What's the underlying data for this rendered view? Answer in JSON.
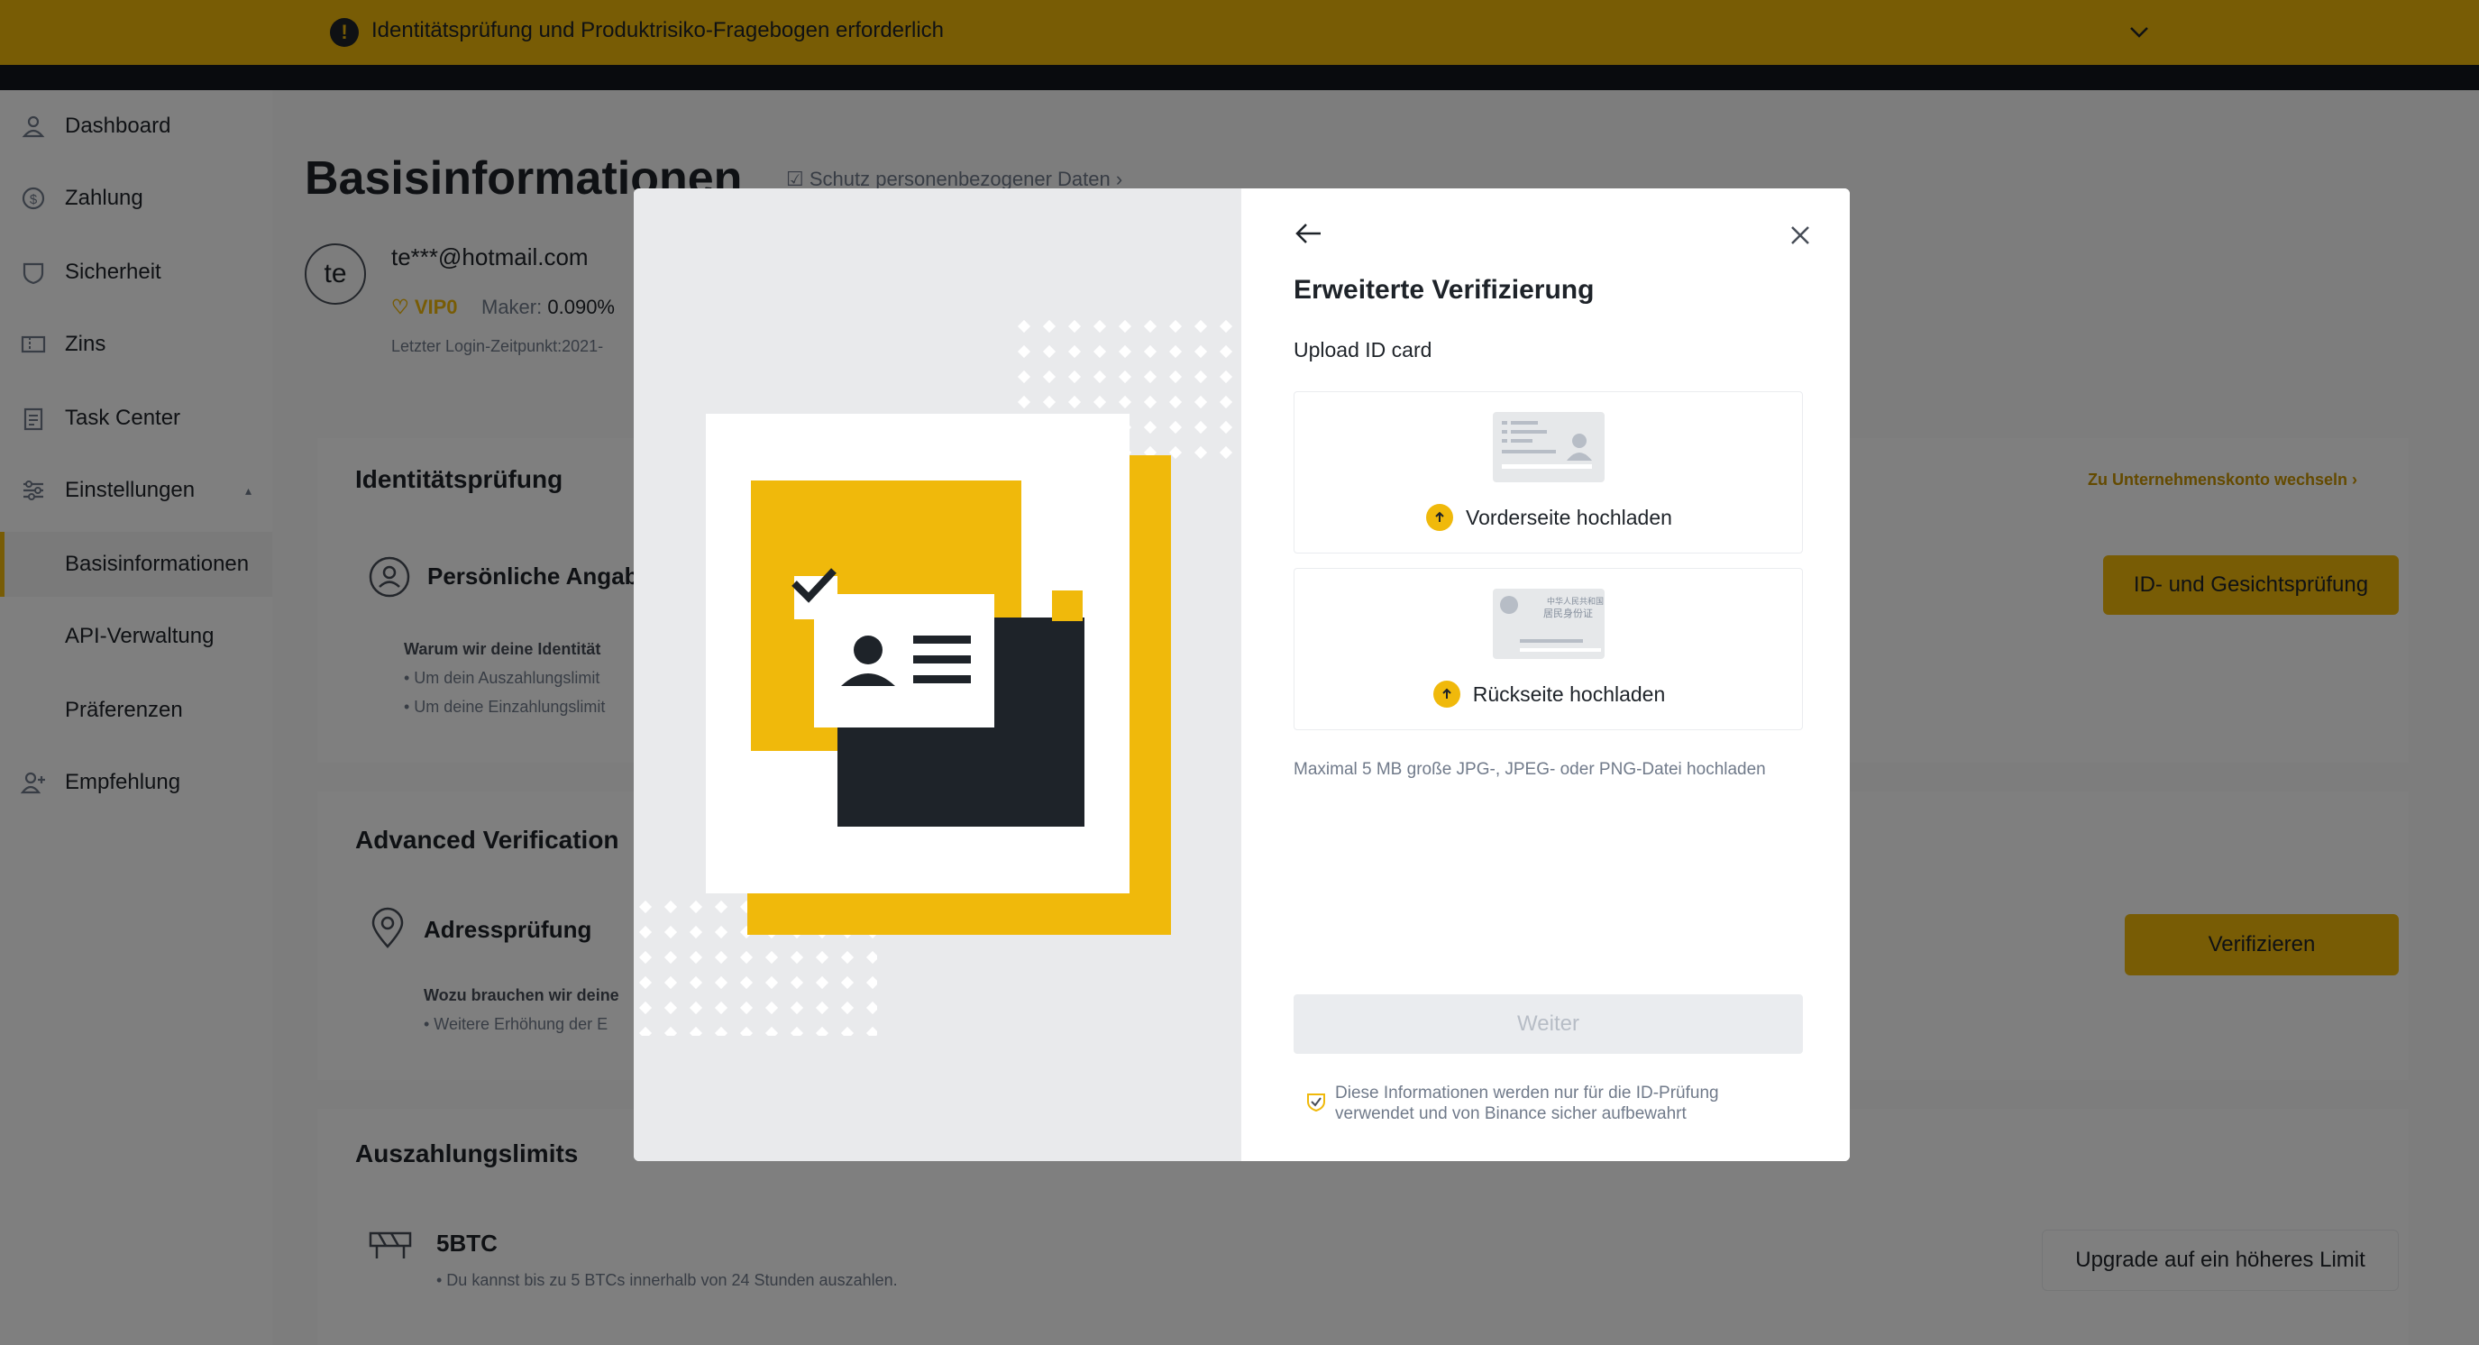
{
  "banner": {
    "text": "Identitätsprüfung und Produktrisiko-Fragebogen erforderlich"
  },
  "sidebar": {
    "items": [
      {
        "label": "Dashboard",
        "icon": "user-icon"
      },
      {
        "label": "Zahlung",
        "icon": "dollar-icon"
      },
      {
        "label": "Sicherheit",
        "icon": "shield-icon"
      },
      {
        "label": "Zins",
        "icon": "ticket-icon"
      },
      {
        "label": "Task Center",
        "icon": "clipboard-icon"
      },
      {
        "label": "Einstellungen",
        "icon": "sliders-icon"
      },
      {
        "label": "Basisinformationen",
        "icon": ""
      },
      {
        "label": "API-Verwaltung",
        "icon": ""
      },
      {
        "label": "Präferenzen",
        "icon": ""
      },
      {
        "label": "Empfehlung",
        "icon": "add-user-icon"
      }
    ]
  },
  "main": {
    "title": "Basisinformationen",
    "privacy_link": "Schutz personenbezogener Daten",
    "avatar": "te",
    "email": "te***@hotmail.com",
    "vip": "VIP0",
    "maker_label": "Maker:",
    "maker_value": "0.090%",
    "last_login": "Letzter Login-Zeitpunkt:2021-",
    "identity": {
      "heading": "Identitätsprüfung",
      "company_link": "Zu Unternehmenskonto wechseln",
      "personal": "Persönliche Angab",
      "why": "Warum wir deine Identität",
      "bullet1": "• Um dein Auszahlungslimit",
      "bullet2": "• Um deine Einzahlungslimit",
      "button": "ID- und Gesichtsprüfung"
    },
    "advanced": {
      "heading": "Advanced Verification",
      "address": "Adressprüfung",
      "why": "Wozu brauchen wir deine",
      "bullet1": "• Weitere Erhöhung der E",
      "button": "Verifizieren"
    },
    "limits": {
      "heading": "Auszahlungslimits",
      "value": "5BTC",
      "desc": "• Du kannst bis zu 5 BTCs innerhalb von 24 Stunden auszahlen.",
      "button": "Upgrade auf ein höheres Limit"
    }
  },
  "modal": {
    "title": "Erweiterte Verifizierung",
    "upload_label": "Upload ID card",
    "front_label": "Vorderseite hochladen",
    "back_label": "Rückseite hochladen",
    "hint": "Maximal 5 MB große JPG-, JPEG- oder PNG-Datei hochladen",
    "next_button": "Weiter",
    "notice": "Diese Informationen werden nur für die ID-Prüfung verwendet und von Binance sicher aufbewahrt",
    "card_back_line1": "中华人民共和国",
    "card_back_line2": "居民身份证"
  },
  "colors": {
    "accent": "#f0b90b",
    "dark": "#1e2329",
    "grey": "#707a8a"
  }
}
